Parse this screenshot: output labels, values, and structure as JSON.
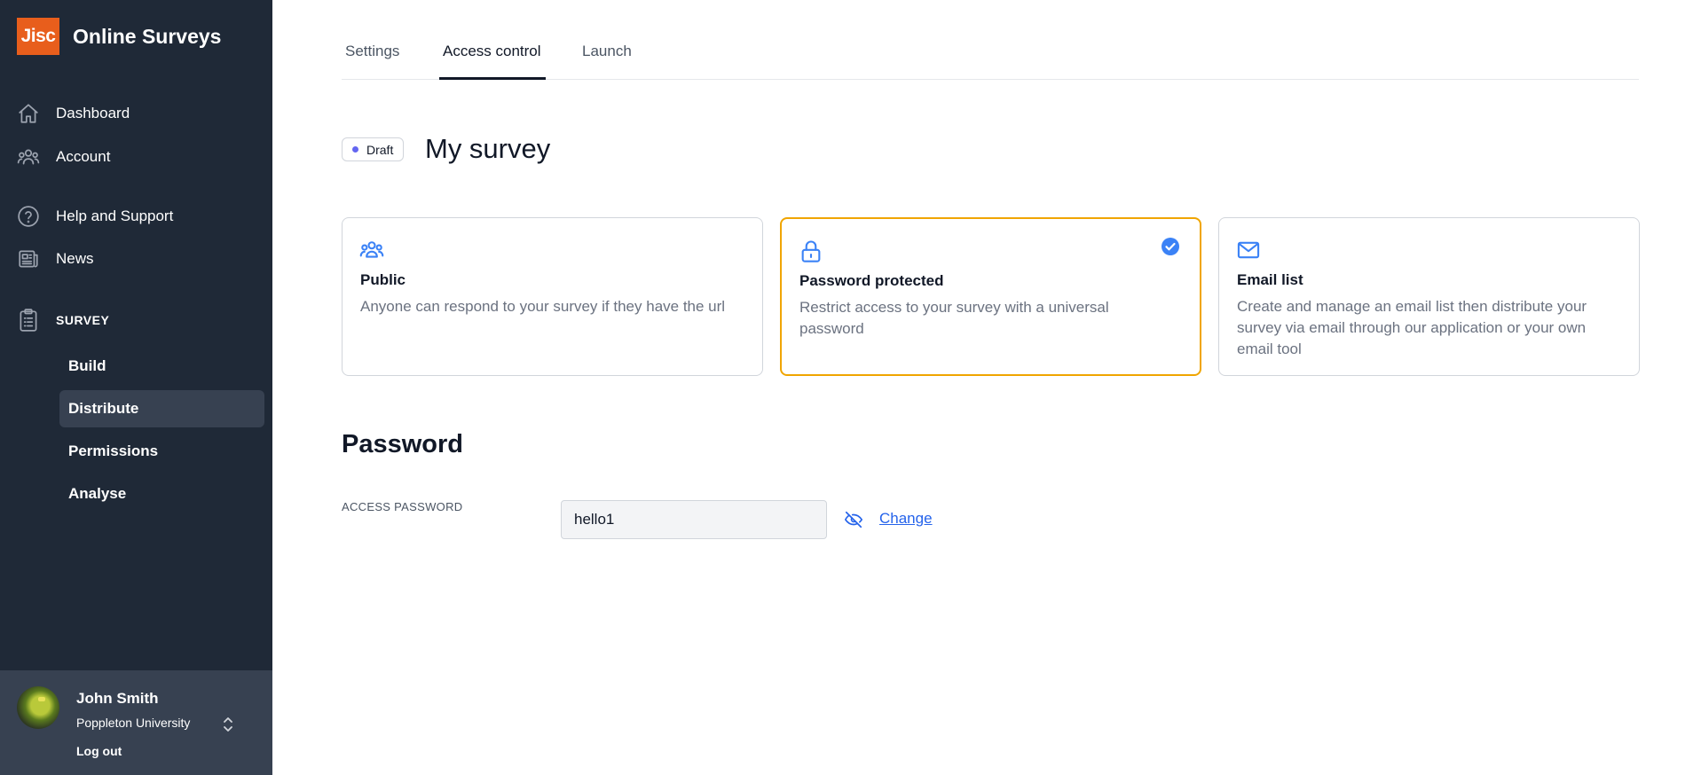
{
  "app": {
    "logo_text": "Jisc",
    "title": "Online Surveys"
  },
  "sidebar": {
    "nav": [
      {
        "label": "Dashboard",
        "icon": "home-icon"
      },
      {
        "label": "Account",
        "icon": "users-icon"
      },
      {
        "label": "Help and Support",
        "icon": "help-circle-icon"
      },
      {
        "label": "News",
        "icon": "newspaper-icon"
      }
    ],
    "survey_section": {
      "label": "SURVEY",
      "icon": "clipboard-icon",
      "items": [
        {
          "label": "Build",
          "active": false
        },
        {
          "label": "Distribute",
          "active": true
        },
        {
          "label": "Permissions",
          "active": false
        },
        {
          "label": "Analyse",
          "active": false
        }
      ]
    },
    "user": {
      "name": "John Smith",
      "organisation": "Poppleton University",
      "logout_label": "Log out"
    }
  },
  "tabs": [
    {
      "label": "Settings",
      "active": false
    },
    {
      "label": "Access control",
      "active": true
    },
    {
      "label": "Launch",
      "active": false
    }
  ],
  "survey": {
    "status": "Draft",
    "status_color": "#6366f1",
    "title": "My survey"
  },
  "access_options": [
    {
      "title": "Public",
      "description": "Anyone can respond to your survey if they have the url",
      "icon": "users-icon",
      "selected": false
    },
    {
      "title": "Password protected",
      "description": "Restrict access to your survey with a universal password",
      "icon": "lock-icon",
      "selected": true
    },
    {
      "title": "Email list",
      "description": "Create and manage an email list then distribute your survey via email through our application or your own email tool",
      "icon": "mail-icon",
      "selected": false
    }
  ],
  "password": {
    "heading": "Password",
    "label": "ACCESS PASSWORD",
    "value": "hello1",
    "change_label": "Change",
    "toggle_icon": "eye-off-icon"
  },
  "colors": {
    "sidebar_bg": "#1f2937",
    "accent": "#e85e1c",
    "selected_border": "#f0a500",
    "link": "#2563eb",
    "icon_blue": "#3b82f6"
  }
}
